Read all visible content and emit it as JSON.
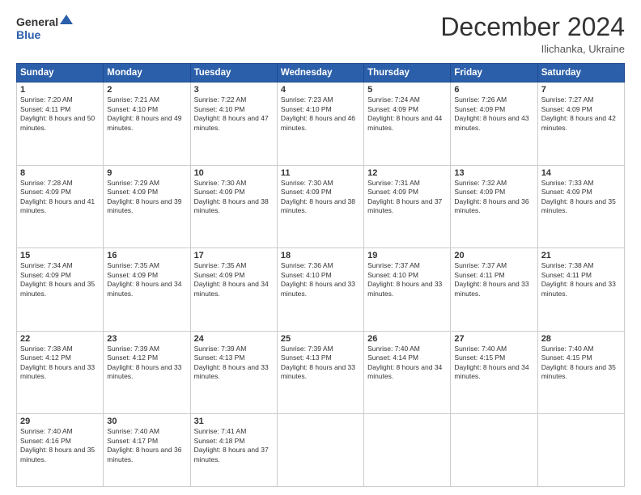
{
  "logo": {
    "line1": "General",
    "line2": "Blue"
  },
  "title": "December 2024",
  "subtitle": "Ilichanka, Ukraine",
  "days_header": [
    "Sunday",
    "Monday",
    "Tuesday",
    "Wednesday",
    "Thursday",
    "Friday",
    "Saturday"
  ],
  "weeks": [
    [
      {
        "num": "1",
        "sunrise": "Sunrise: 7:20 AM",
        "sunset": "Sunset: 4:11 PM",
        "daylight": "Daylight: 8 hours and 50 minutes."
      },
      {
        "num": "2",
        "sunrise": "Sunrise: 7:21 AM",
        "sunset": "Sunset: 4:10 PM",
        "daylight": "Daylight: 8 hours and 49 minutes."
      },
      {
        "num": "3",
        "sunrise": "Sunrise: 7:22 AM",
        "sunset": "Sunset: 4:10 PM",
        "daylight": "Daylight: 8 hours and 47 minutes."
      },
      {
        "num": "4",
        "sunrise": "Sunrise: 7:23 AM",
        "sunset": "Sunset: 4:10 PM",
        "daylight": "Daylight: 8 hours and 46 minutes."
      },
      {
        "num": "5",
        "sunrise": "Sunrise: 7:24 AM",
        "sunset": "Sunset: 4:09 PM",
        "daylight": "Daylight: 8 hours and 44 minutes."
      },
      {
        "num": "6",
        "sunrise": "Sunrise: 7:26 AM",
        "sunset": "Sunset: 4:09 PM",
        "daylight": "Daylight: 8 hours and 43 minutes."
      },
      {
        "num": "7",
        "sunrise": "Sunrise: 7:27 AM",
        "sunset": "Sunset: 4:09 PM",
        "daylight": "Daylight: 8 hours and 42 minutes."
      }
    ],
    [
      {
        "num": "8",
        "sunrise": "Sunrise: 7:28 AM",
        "sunset": "Sunset: 4:09 PM",
        "daylight": "Daylight: 8 hours and 41 minutes."
      },
      {
        "num": "9",
        "sunrise": "Sunrise: 7:29 AM",
        "sunset": "Sunset: 4:09 PM",
        "daylight": "Daylight: 8 hours and 39 minutes."
      },
      {
        "num": "10",
        "sunrise": "Sunrise: 7:30 AM",
        "sunset": "Sunset: 4:09 PM",
        "daylight": "Daylight: 8 hours and 38 minutes."
      },
      {
        "num": "11",
        "sunrise": "Sunrise: 7:30 AM",
        "sunset": "Sunset: 4:09 PM",
        "daylight": "Daylight: 8 hours and 38 minutes."
      },
      {
        "num": "12",
        "sunrise": "Sunrise: 7:31 AM",
        "sunset": "Sunset: 4:09 PM",
        "daylight": "Daylight: 8 hours and 37 minutes."
      },
      {
        "num": "13",
        "sunrise": "Sunrise: 7:32 AM",
        "sunset": "Sunset: 4:09 PM",
        "daylight": "Daylight: 8 hours and 36 minutes."
      },
      {
        "num": "14",
        "sunrise": "Sunrise: 7:33 AM",
        "sunset": "Sunset: 4:09 PM",
        "daylight": "Daylight: 8 hours and 35 minutes."
      }
    ],
    [
      {
        "num": "15",
        "sunrise": "Sunrise: 7:34 AM",
        "sunset": "Sunset: 4:09 PM",
        "daylight": "Daylight: 8 hours and 35 minutes."
      },
      {
        "num": "16",
        "sunrise": "Sunrise: 7:35 AM",
        "sunset": "Sunset: 4:09 PM",
        "daylight": "Daylight: 8 hours and 34 minutes."
      },
      {
        "num": "17",
        "sunrise": "Sunrise: 7:35 AM",
        "sunset": "Sunset: 4:09 PM",
        "daylight": "Daylight: 8 hours and 34 minutes."
      },
      {
        "num": "18",
        "sunrise": "Sunrise: 7:36 AM",
        "sunset": "Sunset: 4:10 PM",
        "daylight": "Daylight: 8 hours and 33 minutes."
      },
      {
        "num": "19",
        "sunrise": "Sunrise: 7:37 AM",
        "sunset": "Sunset: 4:10 PM",
        "daylight": "Daylight: 8 hours and 33 minutes."
      },
      {
        "num": "20",
        "sunrise": "Sunrise: 7:37 AM",
        "sunset": "Sunset: 4:11 PM",
        "daylight": "Daylight: 8 hours and 33 minutes."
      },
      {
        "num": "21",
        "sunrise": "Sunrise: 7:38 AM",
        "sunset": "Sunset: 4:11 PM",
        "daylight": "Daylight: 8 hours and 33 minutes."
      }
    ],
    [
      {
        "num": "22",
        "sunrise": "Sunrise: 7:38 AM",
        "sunset": "Sunset: 4:12 PM",
        "daylight": "Daylight: 8 hours and 33 minutes."
      },
      {
        "num": "23",
        "sunrise": "Sunrise: 7:39 AM",
        "sunset": "Sunset: 4:12 PM",
        "daylight": "Daylight: 8 hours and 33 minutes."
      },
      {
        "num": "24",
        "sunrise": "Sunrise: 7:39 AM",
        "sunset": "Sunset: 4:13 PM",
        "daylight": "Daylight: 8 hours and 33 minutes."
      },
      {
        "num": "25",
        "sunrise": "Sunrise: 7:39 AM",
        "sunset": "Sunset: 4:13 PM",
        "daylight": "Daylight: 8 hours and 33 minutes."
      },
      {
        "num": "26",
        "sunrise": "Sunrise: 7:40 AM",
        "sunset": "Sunset: 4:14 PM",
        "daylight": "Daylight: 8 hours and 34 minutes."
      },
      {
        "num": "27",
        "sunrise": "Sunrise: 7:40 AM",
        "sunset": "Sunset: 4:15 PM",
        "daylight": "Daylight: 8 hours and 34 minutes."
      },
      {
        "num": "28",
        "sunrise": "Sunrise: 7:40 AM",
        "sunset": "Sunset: 4:15 PM",
        "daylight": "Daylight: 8 hours and 35 minutes."
      }
    ],
    [
      {
        "num": "29",
        "sunrise": "Sunrise: 7:40 AM",
        "sunset": "Sunset: 4:16 PM",
        "daylight": "Daylight: 8 hours and 35 minutes."
      },
      {
        "num": "30",
        "sunrise": "Sunrise: 7:40 AM",
        "sunset": "Sunset: 4:17 PM",
        "daylight": "Daylight: 8 hours and 36 minutes."
      },
      {
        "num": "31",
        "sunrise": "Sunrise: 7:41 AM",
        "sunset": "Sunset: 4:18 PM",
        "daylight": "Daylight: 8 hours and 37 minutes."
      },
      null,
      null,
      null,
      null
    ]
  ]
}
